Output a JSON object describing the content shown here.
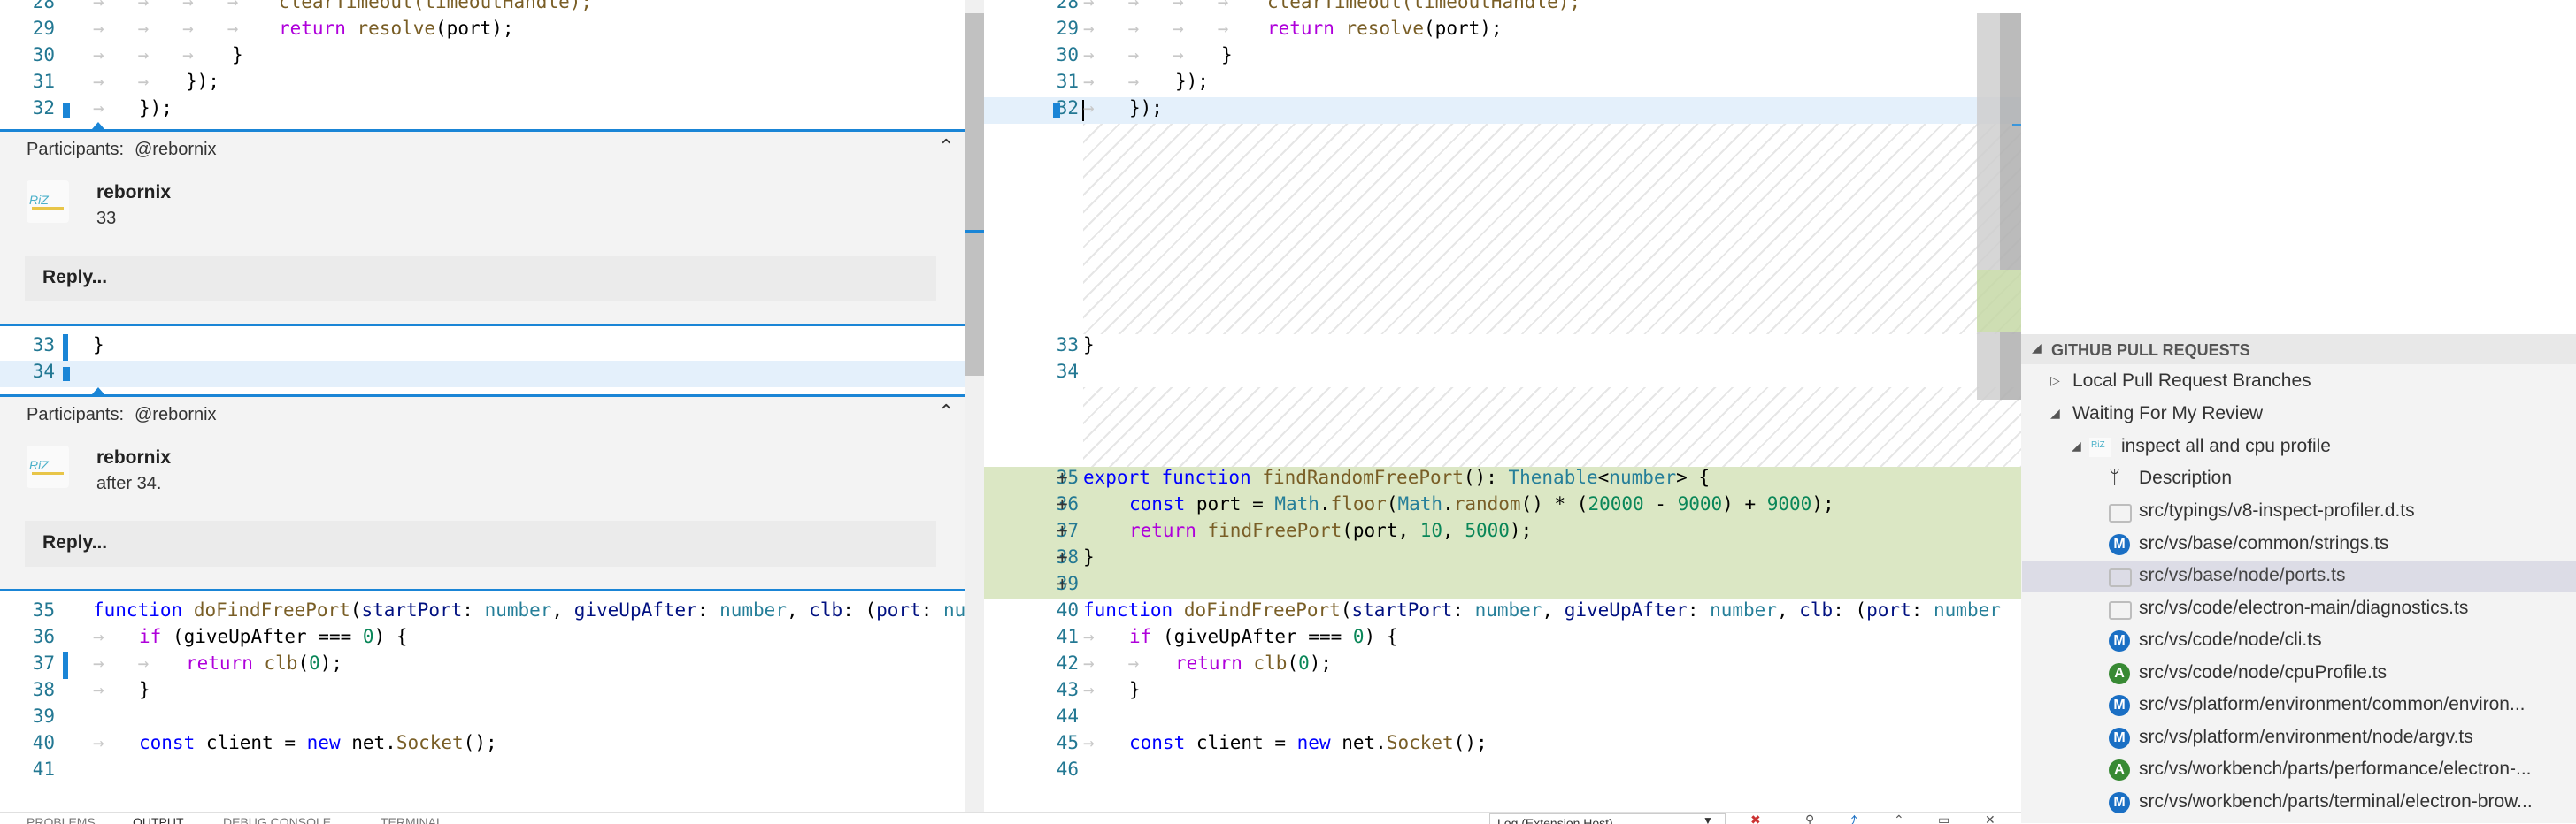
{
  "left_editor": {
    "top_lines": [
      {
        "n": "28",
        "code": "clearTimeout(timeoutHandle);"
      },
      {
        "n": "29",
        "code": "return resolve(port);"
      },
      {
        "n": "30",
        "code": "}"
      },
      {
        "n": "31",
        "code": "});"
      },
      {
        "n": "32",
        "code": "});"
      }
    ],
    "mid_lines": [
      {
        "n": "33",
        "code": "}"
      },
      {
        "n": "34",
        "code": ""
      }
    ],
    "bottom_lines": [
      {
        "n": "35",
        "code": "function doFindFreePort(startPort: number, giveUpAfter: number, clb: (port: nu"
      },
      {
        "n": "36",
        "code": "if (giveUpAfter === 0) {"
      },
      {
        "n": "37",
        "code": "return clb(0);"
      },
      {
        "n": "38",
        "code": "}"
      },
      {
        "n": "39",
        "code": ""
      },
      {
        "n": "40",
        "code": "const client = new net.Socket();"
      },
      {
        "n": "41",
        "code": ""
      }
    ],
    "threads": [
      {
        "participants_label": "Participants:",
        "participants": "@rebornix",
        "author": "rebornix",
        "body": "33",
        "reply": "Reply..."
      },
      {
        "participants_label": "Participants:",
        "participants": "@rebornix",
        "author": "rebornix",
        "body": "after 34.",
        "reply": "Reply..."
      }
    ]
  },
  "right_editor": {
    "top_lines": [
      {
        "n": "28",
        "code": "clearTimeout(timeoutHandle);"
      },
      {
        "n": "29",
        "code": "return resolve(port);"
      },
      {
        "n": "30",
        "code": "}"
      },
      {
        "n": "31",
        "code": "});"
      },
      {
        "n": "32",
        "code": "});"
      }
    ],
    "mid_lines": [
      {
        "n": "33",
        "code": "}"
      },
      {
        "n": "34",
        "code": ""
      }
    ],
    "added_lines": [
      {
        "n": "35",
        "code": "export function findRandomFreePort(): Thenable<number> {"
      },
      {
        "n": "36",
        "code": "const port = Math.floor(Math.random() * (20000 - 9000) + 9000);"
      },
      {
        "n": "37",
        "code": "return findFreePort(port, 10, 5000);"
      },
      {
        "n": "38",
        "code": "}"
      },
      {
        "n": "39",
        "code": ""
      }
    ],
    "bottom_lines": [
      {
        "n": "40",
        "code": "function doFindFreePort(startPort: number, giveUpAfter: number, clb: (port: number"
      },
      {
        "n": "41",
        "code": "if (giveUpAfter === 0) {"
      },
      {
        "n": "42",
        "code": "return clb(0);"
      },
      {
        "n": "43",
        "code": "}"
      },
      {
        "n": "44",
        "code": ""
      },
      {
        "n": "45",
        "code": "const client = new net.Socket();"
      },
      {
        "n": "46",
        "code": ""
      }
    ]
  },
  "sidebar": {
    "section_title": "GITHUB PULL REQUESTS",
    "items": [
      {
        "label": "Local Pull Request Branches",
        "kind": "collapsed"
      },
      {
        "label": "Waiting For My Review",
        "kind": "expanded"
      },
      {
        "label": "inspect all and cpu profile",
        "kind": "pr"
      },
      {
        "label": "Description",
        "kind": "description"
      },
      {
        "label": "src/typings/v8-inspect-profiler.d.ts",
        "kind": "comment",
        "badge": ""
      },
      {
        "label": "src/vs/base/common/strings.ts",
        "kind": "file",
        "badge": "M",
        "color": "#1a6fc4"
      },
      {
        "label": "src/vs/base/node/ports.ts",
        "kind": "comment",
        "badge": "",
        "selected": true
      },
      {
        "label": "src/vs/code/electron-main/diagnostics.ts",
        "kind": "comment",
        "badge": ""
      },
      {
        "label": "src/vs/code/node/cli.ts",
        "kind": "file",
        "badge": "M",
        "color": "#1a6fc4"
      },
      {
        "label": "src/vs/code/node/cpuProfile.ts",
        "kind": "file",
        "badge": "A",
        "color": "#388a34"
      },
      {
        "label": "src/vs/platform/environment/common/environ...",
        "kind": "file",
        "badge": "M",
        "color": "#1a6fc4"
      },
      {
        "label": "src/vs/platform/environment/node/argv.ts",
        "kind": "file",
        "badge": "M",
        "color": "#1a6fc4"
      },
      {
        "label": "src/vs/workbench/parts/performance/electron-...",
        "kind": "file",
        "badge": "A",
        "color": "#388a34"
      },
      {
        "label": "src/vs/workbench/parts/terminal/electron-brow...",
        "kind": "file",
        "badge": "M",
        "color": "#1a6fc4"
      }
    ]
  },
  "panel": {
    "tabs": [
      "PROBLEMS",
      "OUTPUT",
      "DEBUG CONSOLE",
      "TERMINAL"
    ],
    "dropdown": "Log (Extension Host)"
  }
}
